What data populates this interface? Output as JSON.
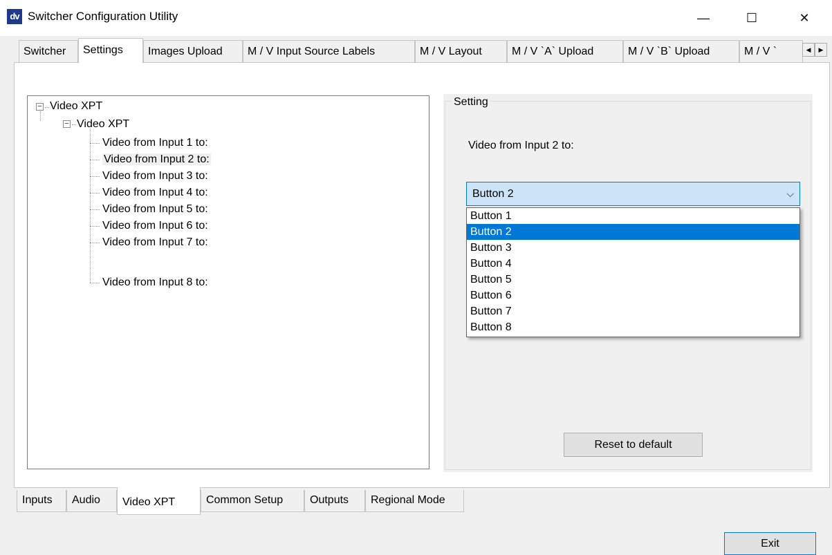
{
  "window": {
    "icon_text": "dv",
    "title": "Switcher Configuration Utility",
    "minimize_glyph": "—",
    "maximize_glyph": "☐",
    "close_glyph": "✕"
  },
  "top_tabs": [
    {
      "label": "Switcher"
    },
    {
      "label": "Settings"
    },
    {
      "label": "Images Upload"
    },
    {
      "label": "M / V  Input Source Labels"
    },
    {
      "label": "M / V Layout"
    },
    {
      "label": "M / V `A` Upload"
    },
    {
      "label": "M / V `B` Upload"
    },
    {
      "label": "M / V `"
    }
  ],
  "top_tab_scroll": {
    "left": "◀",
    "right": "▶"
  },
  "tree": {
    "root": "Video XPT",
    "child": "Video XPT",
    "expander_glyph": "−",
    "items": [
      "Video from Input 1 to:",
      "Video from Input 2 to:",
      "Video from Input 3 to:",
      "Video from Input 4 to:",
      "Video from Input 5 to:",
      "Video from Input 6 to:",
      "Video from Input 7 to:",
      "Video from Input 8 to:"
    ],
    "selected_index": 1
  },
  "setting": {
    "legend": "Setting",
    "description": "Video from Input 2 to:",
    "combo_value": "Button 2",
    "combo_arrow": "⌵",
    "options": [
      "Button 1",
      "Button 2",
      "Button 3",
      "Button 4",
      "Button 5",
      "Button 6",
      "Button 7",
      "Button 8"
    ],
    "selected_option_index": 1,
    "reset_label": "Reset to default"
  },
  "bottom_tabs": [
    {
      "label": "Inputs"
    },
    {
      "label": "Audio"
    },
    {
      "label": "Video XPT"
    },
    {
      "label": "Common Setup"
    },
    {
      "label": "Outputs"
    },
    {
      "label": "Regional Mode"
    }
  ],
  "exit_label": "Exit",
  "colors": {
    "accent": "#0078d7",
    "combo_bg": "#cce4f7",
    "window_bg": "#f0f0f0"
  }
}
